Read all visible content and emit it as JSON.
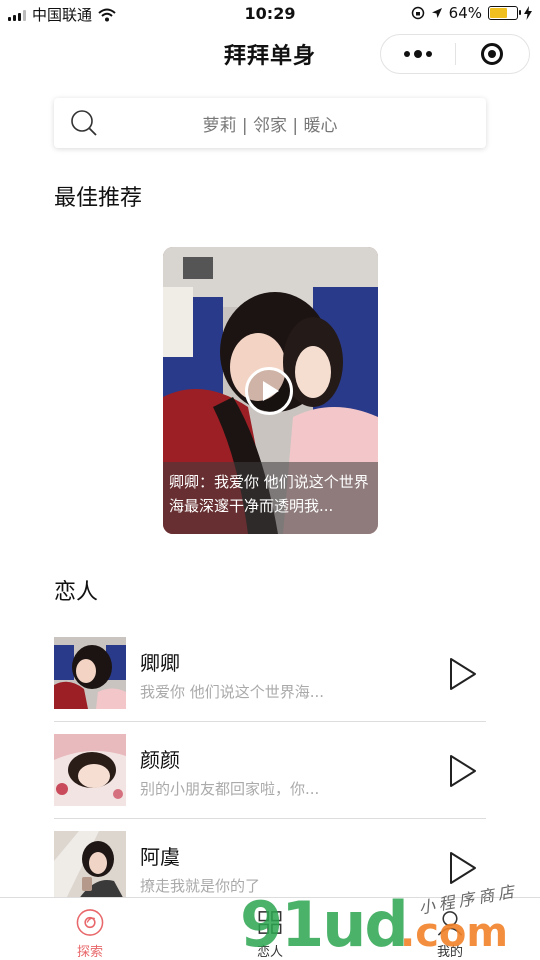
{
  "status_bar": {
    "carrier": "中国联通",
    "time": "10:29",
    "battery_percent_text": "64%",
    "battery_level": 0.64
  },
  "nav": {
    "title": "拜拜单身"
  },
  "search": {
    "placeholder": "萝莉 | 邻家 | 暖心"
  },
  "featured": {
    "section_title": "最佳推荐",
    "caption": "卿卿：我爱你 他们说这个世界海最深邃干净而透明我..."
  },
  "lovers": {
    "section_title": "恋人",
    "items": [
      {
        "name": "卿卿",
        "desc": "我爱你 他们说这个世界海..."
      },
      {
        "name": "颜颜",
        "desc": "别的小朋友都回家啦，你..."
      },
      {
        "name": "阿虞",
        "desc": "撩走我就是你的了"
      }
    ]
  },
  "tabs": [
    {
      "label": "探索",
      "icon": "explore-icon",
      "active": true
    },
    {
      "label": "恋人",
      "icon": "grid-icon",
      "active": false
    },
    {
      "label": "我的",
      "icon": "profile-icon",
      "active": false
    }
  ],
  "watermark": {
    "main": "91ud",
    "dot": ".com",
    "sub": "小程序商店"
  },
  "colors": {
    "accent": "#e8676a",
    "watermark_green": "#2ba550",
    "watermark_orange": "#f18228"
  }
}
